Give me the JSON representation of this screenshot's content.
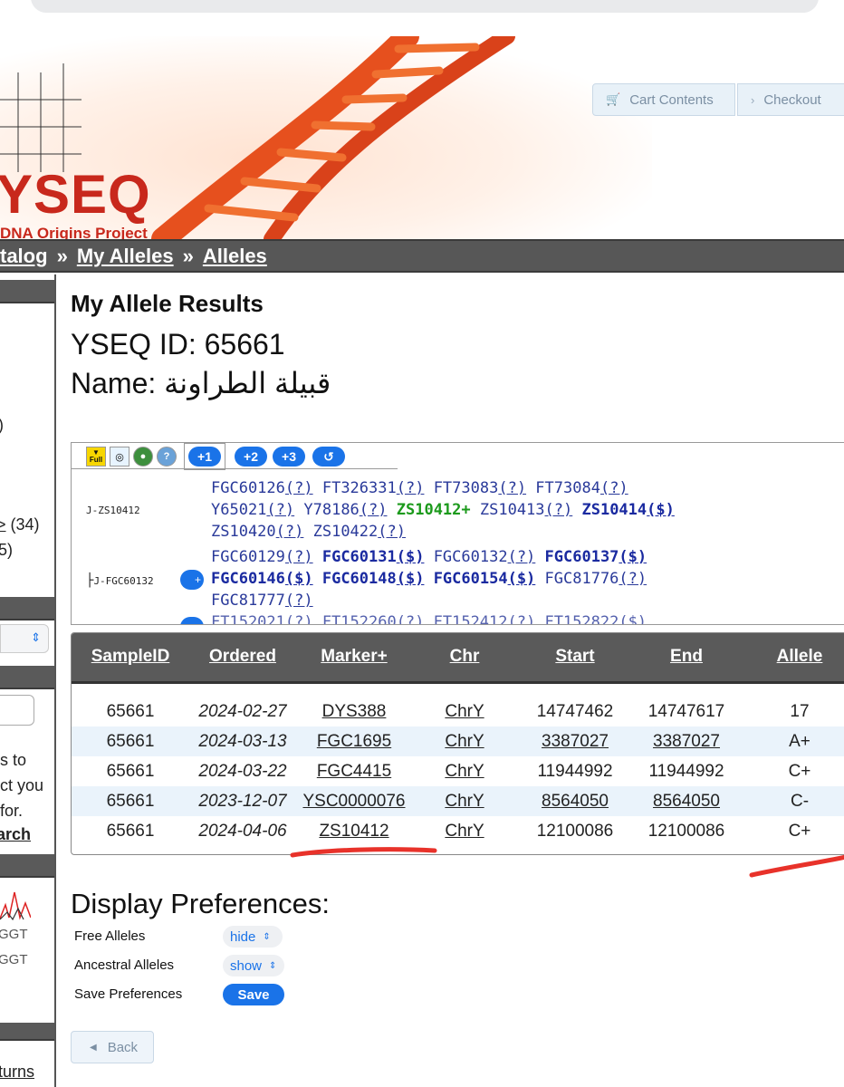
{
  "header": {
    "logo_main": "YSEQ",
    "logo_sub": "DNA Origins Project",
    "cart_label": "Cart Contents",
    "checkout_label": "Checkout"
  },
  "breadcrumb": [
    "talog",
    "My Alleles",
    "Alleles"
  ],
  "left_column": {
    "text_1": ")",
    "link_count_text": "> (34)",
    "count_2": "5)",
    "help_text_1": "s to",
    "help_text_2": "ct you",
    "help_text_3": "for.",
    "search_label": "arch",
    "dna_text_1": "GGT",
    "dna_text_2": "GGT",
    "bottom_link": "turns"
  },
  "main": {
    "title": "My Allele Results",
    "yseq_id_text": "YSEQ ID: 65661",
    "name_text": "Name: قبيلة الطراونة"
  },
  "tree": {
    "toolbar": {
      "full_label": "Full",
      "plus1": "+1",
      "plus2": "+2",
      "plus3": "+3",
      "reset_icon": "↺"
    },
    "node1_label": "J-ZS10412",
    "node2_label": "J-FGC60132",
    "node2_plus": "+",
    "rows": [
      [
        {
          "t": "FGC60126",
          "s": "n"
        },
        {
          "t": "(?)",
          "s": "q"
        },
        {
          "t": " FT326331",
          "s": "n"
        },
        {
          "t": "(?)",
          "s": "q"
        },
        {
          "t": " FT73083",
          "s": "n"
        },
        {
          "t": "(?)",
          "s": "q"
        },
        {
          "t": " FT73084",
          "s": "n"
        },
        {
          "t": "(?)",
          "s": "q"
        }
      ],
      [
        {
          "t": "Y65021",
          "s": "n"
        },
        {
          "t": "(?)",
          "s": "q"
        },
        {
          "t": " Y78186",
          "s": "n"
        },
        {
          "t": "(?)",
          "s": "q"
        },
        {
          "t": " ZS10412+",
          "s": "g"
        },
        {
          "t": " ZS10413",
          "s": "n"
        },
        {
          "t": "(?)",
          "s": "q"
        },
        {
          "t": " ZS10414",
          "s": "b"
        },
        {
          "t": "($)",
          "s": "bq"
        }
      ],
      [
        {
          "t": "ZS10420",
          "s": "n"
        },
        {
          "t": "(?)",
          "s": "q"
        },
        {
          "t": " ZS10422",
          "s": "n"
        },
        {
          "t": "(?)",
          "s": "q"
        }
      ],
      [
        {
          "t": "FGC60129",
          "s": "n"
        },
        {
          "t": "(?)",
          "s": "q"
        },
        {
          "t": " FGC60131",
          "s": "b"
        },
        {
          "t": "($)",
          "s": "bq"
        },
        {
          "t": " FGC60132",
          "s": "n"
        },
        {
          "t": "(?)",
          "s": "q"
        },
        {
          "t": " FGC60137",
          "s": "b"
        },
        {
          "t": "($)",
          "s": "bq"
        }
      ],
      [
        {
          "t": "FGC60146",
          "s": "b"
        },
        {
          "t": "($)",
          "s": "bq"
        },
        {
          "t": " FGC60148",
          "s": "b"
        },
        {
          "t": "($)",
          "s": "bq"
        },
        {
          "t": " FGC60154",
          "s": "b"
        },
        {
          "t": "($)",
          "s": "bq"
        },
        {
          "t": " FGC81776",
          "s": "n"
        },
        {
          "t": "(?)",
          "s": "q"
        }
      ],
      [
        {
          "t": "FGC81777",
          "s": "n"
        },
        {
          "t": "(?)",
          "s": "q"
        }
      ]
    ]
  },
  "results": {
    "columns": [
      "SampleID",
      "Ordered",
      "Marker+",
      "Chr",
      "Start",
      "End",
      "Allele"
    ],
    "rows": [
      [
        "65661",
        "2024-02-27",
        "DYS388",
        "ChrY",
        "14747462",
        "14747617",
        "17"
      ],
      [
        "65661",
        "2024-03-13",
        "FGC1695",
        "ChrY",
        "3387027",
        "3387027",
        "A+"
      ],
      [
        "65661",
        "2024-03-22",
        "FGC4415",
        "ChrY",
        "11944992",
        "11944992",
        "C+"
      ],
      [
        "65661",
        "2023-12-07",
        "YSC0000076",
        "ChrY",
        "8564050",
        "8564050",
        "C-"
      ],
      [
        "65661",
        "2024-04-06",
        "ZS10412",
        "ChrY",
        "12100086",
        "12100086",
        "C+"
      ]
    ],
    "linked_start": [
      false,
      true,
      false,
      true,
      false
    ],
    "linked_end": [
      false,
      true,
      false,
      true,
      false
    ]
  },
  "prefs": {
    "title": "Display Preferences:",
    "free_label": "Free Alleles",
    "free_value": "hide",
    "ancestral_label": "Ancestral Alleles",
    "ancestral_value": "show",
    "save_label": "Save Preferences",
    "save_button": "Save"
  },
  "back_label": "Back",
  "colors": {
    "brand_red": "#c8281c",
    "accent_blue": "#1a73e8",
    "header_gray": "#5a5a5a",
    "alt_row": "#eaf3fb",
    "annotation_red": "#e8322a"
  }
}
